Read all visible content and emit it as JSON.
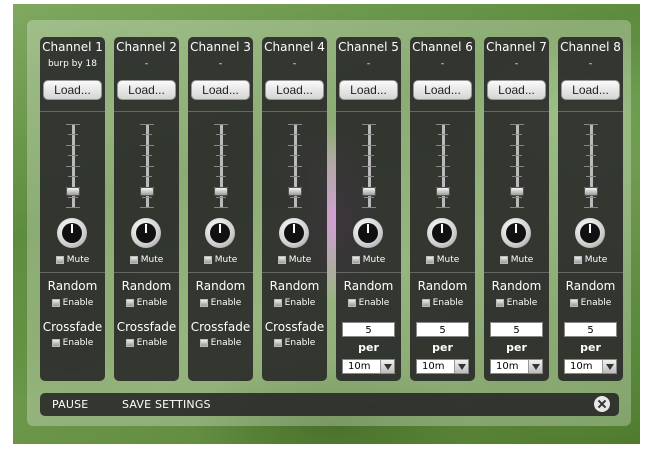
{
  "channels": [
    {
      "title": "Channel 1",
      "file": "burp by 18",
      "load_label": "Load...",
      "mute_label": "Mute",
      "random_label": "Random",
      "random_enable_label": "Enable",
      "mode": "crossfade",
      "crossfade_label": "Crossfade",
      "crossfade_enable_label": "Enable"
    },
    {
      "title": "Channel 2",
      "file": "-",
      "load_label": "Load...",
      "mute_label": "Mute",
      "random_label": "Random",
      "random_enable_label": "Enable",
      "mode": "crossfade",
      "crossfade_label": "Crossfade",
      "crossfade_enable_label": "Enable"
    },
    {
      "title": "Channel 3",
      "file": "-",
      "load_label": "Load...",
      "mute_label": "Mute",
      "random_label": "Random",
      "random_enable_label": "Enable",
      "mode": "crossfade",
      "crossfade_label": "Crossfade",
      "crossfade_enable_label": "Enable"
    },
    {
      "title": "Channel 4",
      "file": "-",
      "load_label": "Load...",
      "mute_label": "Mute",
      "random_label": "Random",
      "random_enable_label": "Enable",
      "mode": "crossfade",
      "crossfade_label": "Crossfade",
      "crossfade_enable_label": "Enable"
    },
    {
      "title": "Channel 5",
      "file": "-",
      "load_label": "Load...",
      "mute_label": "Mute",
      "random_label": "Random",
      "random_enable_label": "Enable",
      "mode": "per",
      "count": "5",
      "per_label": "per",
      "period": "10m"
    },
    {
      "title": "Channel 6",
      "file": "-",
      "load_label": "Load...",
      "mute_label": "Mute",
      "random_label": "Random",
      "random_enable_label": "Enable",
      "mode": "per",
      "count": "5",
      "per_label": "per",
      "period": "10m"
    },
    {
      "title": "Channel 7",
      "file": "-",
      "load_label": "Load...",
      "mute_label": "Mute",
      "random_label": "Random",
      "random_enable_label": "Enable",
      "mode": "per",
      "count": "5",
      "per_label": "per",
      "period": "10m"
    },
    {
      "title": "Channel 8",
      "file": "-",
      "load_label": "Load...",
      "mute_label": "Mute",
      "random_label": "Random",
      "random_enable_label": "Enable",
      "mode": "per",
      "count": "5",
      "per_label": "per",
      "period": "10m"
    }
  ],
  "bottom_bar": {
    "pause_label": "PAUSE",
    "save_label": "SAVE SETTINGS",
    "close_icon": "close-icon"
  },
  "colors": {
    "panel": "#262626",
    "text": "#ffffff",
    "background_highlight": "#cd78d7"
  }
}
